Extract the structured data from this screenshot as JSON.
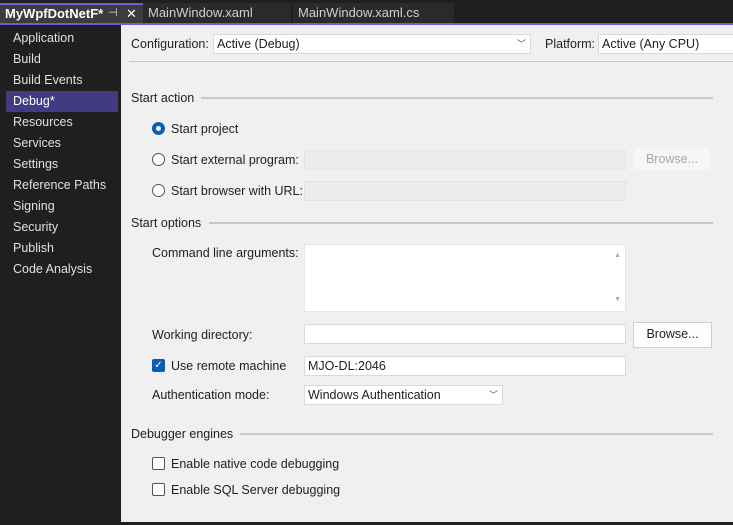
{
  "tabs": [
    {
      "label": "MyWpfDotNetF*",
      "active": true
    },
    {
      "label": "MainWindow.xaml"
    },
    {
      "label": "MainWindow.xaml.cs"
    }
  ],
  "tab_icons": {
    "pin": "⊣",
    "close": "✕"
  },
  "sidebar": {
    "items": [
      {
        "label": "Application"
      },
      {
        "label": "Build"
      },
      {
        "label": "Build Events"
      },
      {
        "label": "Debug*",
        "selected": true
      },
      {
        "label": "Resources"
      },
      {
        "label": "Services"
      },
      {
        "label": "Settings"
      },
      {
        "label": "Reference Paths"
      },
      {
        "label": "Signing"
      },
      {
        "label": "Security"
      },
      {
        "label": "Publish"
      },
      {
        "label": "Code Analysis"
      }
    ]
  },
  "config": {
    "label": "Configuration:",
    "value": "Active (Debug)",
    "platform_label": "Platform:",
    "platform_value": "Active (Any CPU)"
  },
  "start_action": {
    "title": "Start action",
    "start_project": "Start project",
    "external": "Start external program:",
    "external_value": "",
    "browser": "Start browser with URL:",
    "browser_value": "",
    "browse": "Browse...",
    "selected": "start_project"
  },
  "start_options": {
    "title": "Start options",
    "cmd_label": "Command line arguments:",
    "cmd_value": "",
    "wd_label": "Working directory:",
    "wd_value": "",
    "browse": "Browse...",
    "remote_label": "Use remote machine",
    "remote_checked": true,
    "remote_value": "MJO-DL:2046",
    "auth_label": "Authentication mode:",
    "auth_value": "Windows Authentication"
  },
  "debugger": {
    "title": "Debugger engines",
    "native": "Enable native code debugging",
    "native_checked": false,
    "sql": "Enable SQL Server debugging",
    "sql_checked": false
  },
  "colors": {
    "accent": "#6e5ecf",
    "selected_item": "#433a84",
    "control_blue": "#0a5fb4"
  }
}
